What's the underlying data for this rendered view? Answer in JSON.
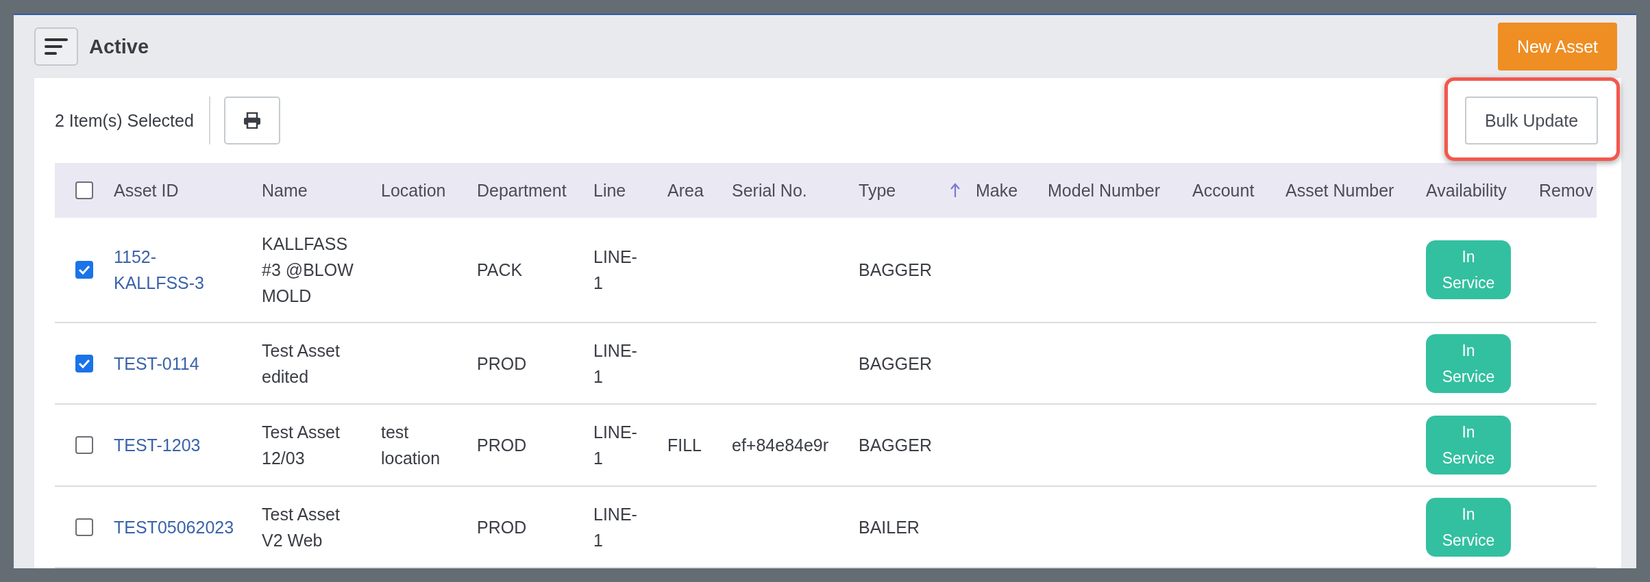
{
  "header": {
    "title": "Active",
    "new_button": "New Asset"
  },
  "toolbar": {
    "selection_count": "2 Item(s) Selected",
    "bulk_update": "Bulk Update",
    "bulk_update_highlighted": true
  },
  "table": {
    "select_all_checked": false,
    "columns": [
      {
        "label": "Asset ID",
        "sorted": false
      },
      {
        "label": "Name",
        "sorted": false
      },
      {
        "label": "Location",
        "sorted": false
      },
      {
        "label": "Department",
        "sorted": false
      },
      {
        "label": "Line",
        "sorted": false
      },
      {
        "label": "Area",
        "sorted": false
      },
      {
        "label": "Serial No.",
        "sorted": false
      },
      {
        "label": "Type",
        "sorted": false
      },
      {
        "label": "Make",
        "sorted": true
      },
      {
        "label": "Model Number",
        "sorted": false
      },
      {
        "label": "Account",
        "sorted": false
      },
      {
        "label": "Asset Number",
        "sorted": false
      },
      {
        "label": "Availability",
        "sorted": false
      },
      {
        "label": "Remov",
        "sorted": false
      }
    ],
    "rows": [
      {
        "checked": true,
        "cells": [
          "1152-KALLFSS-3",
          "KALLFASS #3 @BLOW MOLD",
          null,
          "PACK",
          "LINE-1",
          null,
          null,
          "BAGGER",
          null,
          null,
          null,
          null,
          "In Service"
        ]
      },
      {
        "checked": true,
        "cells": [
          "TEST-0114",
          "Test Asset edited",
          null,
          "PROD",
          "LINE-1",
          null,
          null,
          "BAGGER",
          null,
          null,
          null,
          null,
          "In Service"
        ]
      },
      {
        "checked": false,
        "cells": [
          "TEST-1203",
          "Test Asset 12/03",
          "test location",
          "PROD",
          "LINE-1",
          "FILL",
          "ef+84e84e9r",
          "BAGGER",
          null,
          null,
          null,
          null,
          "In Service"
        ]
      },
      {
        "checked": false,
        "cells": [
          "TEST05062023",
          "Test Asset V2 Web",
          null,
          "PROD",
          "LINE-1",
          null,
          null,
          "BAILER",
          null,
          null,
          null,
          null,
          "In Service"
        ]
      }
    ]
  }
}
